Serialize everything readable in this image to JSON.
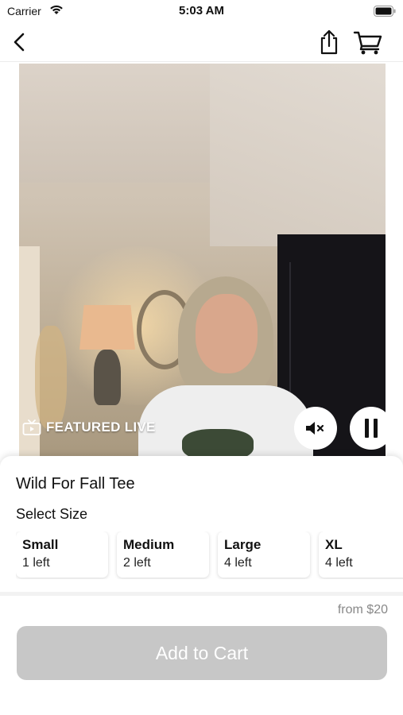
{
  "status_bar": {
    "carrier": "Carrier",
    "time": "5:03 AM",
    "wifi_icon": "wifi-icon",
    "battery_icon": "battery-icon"
  },
  "nav": {
    "back_icon": "chevron-left-icon",
    "share_icon": "share-icon",
    "cart_icon": "cart-icon"
  },
  "video": {
    "badge_label": "FEATURED LIVE",
    "badge_icon": "tv-icon",
    "mute_icon": "speaker-mute-icon",
    "pause_icon": "pause-icon"
  },
  "product": {
    "title": "Wild For Fall Tee",
    "size_heading": "Select Size",
    "sizes": [
      {
        "name": "Small",
        "stock": "1 left"
      },
      {
        "name": "Medium",
        "stock": "2 left"
      },
      {
        "name": "Large",
        "stock": "4 left"
      },
      {
        "name": "XL",
        "stock": "4 left"
      }
    ],
    "price": "from $20",
    "add_to_cart_label": "Add to Cart"
  },
  "colors": {
    "add_to_cart_disabled": "#c7c7c7",
    "price_text": "#888888",
    "background": "#ffffff"
  }
}
